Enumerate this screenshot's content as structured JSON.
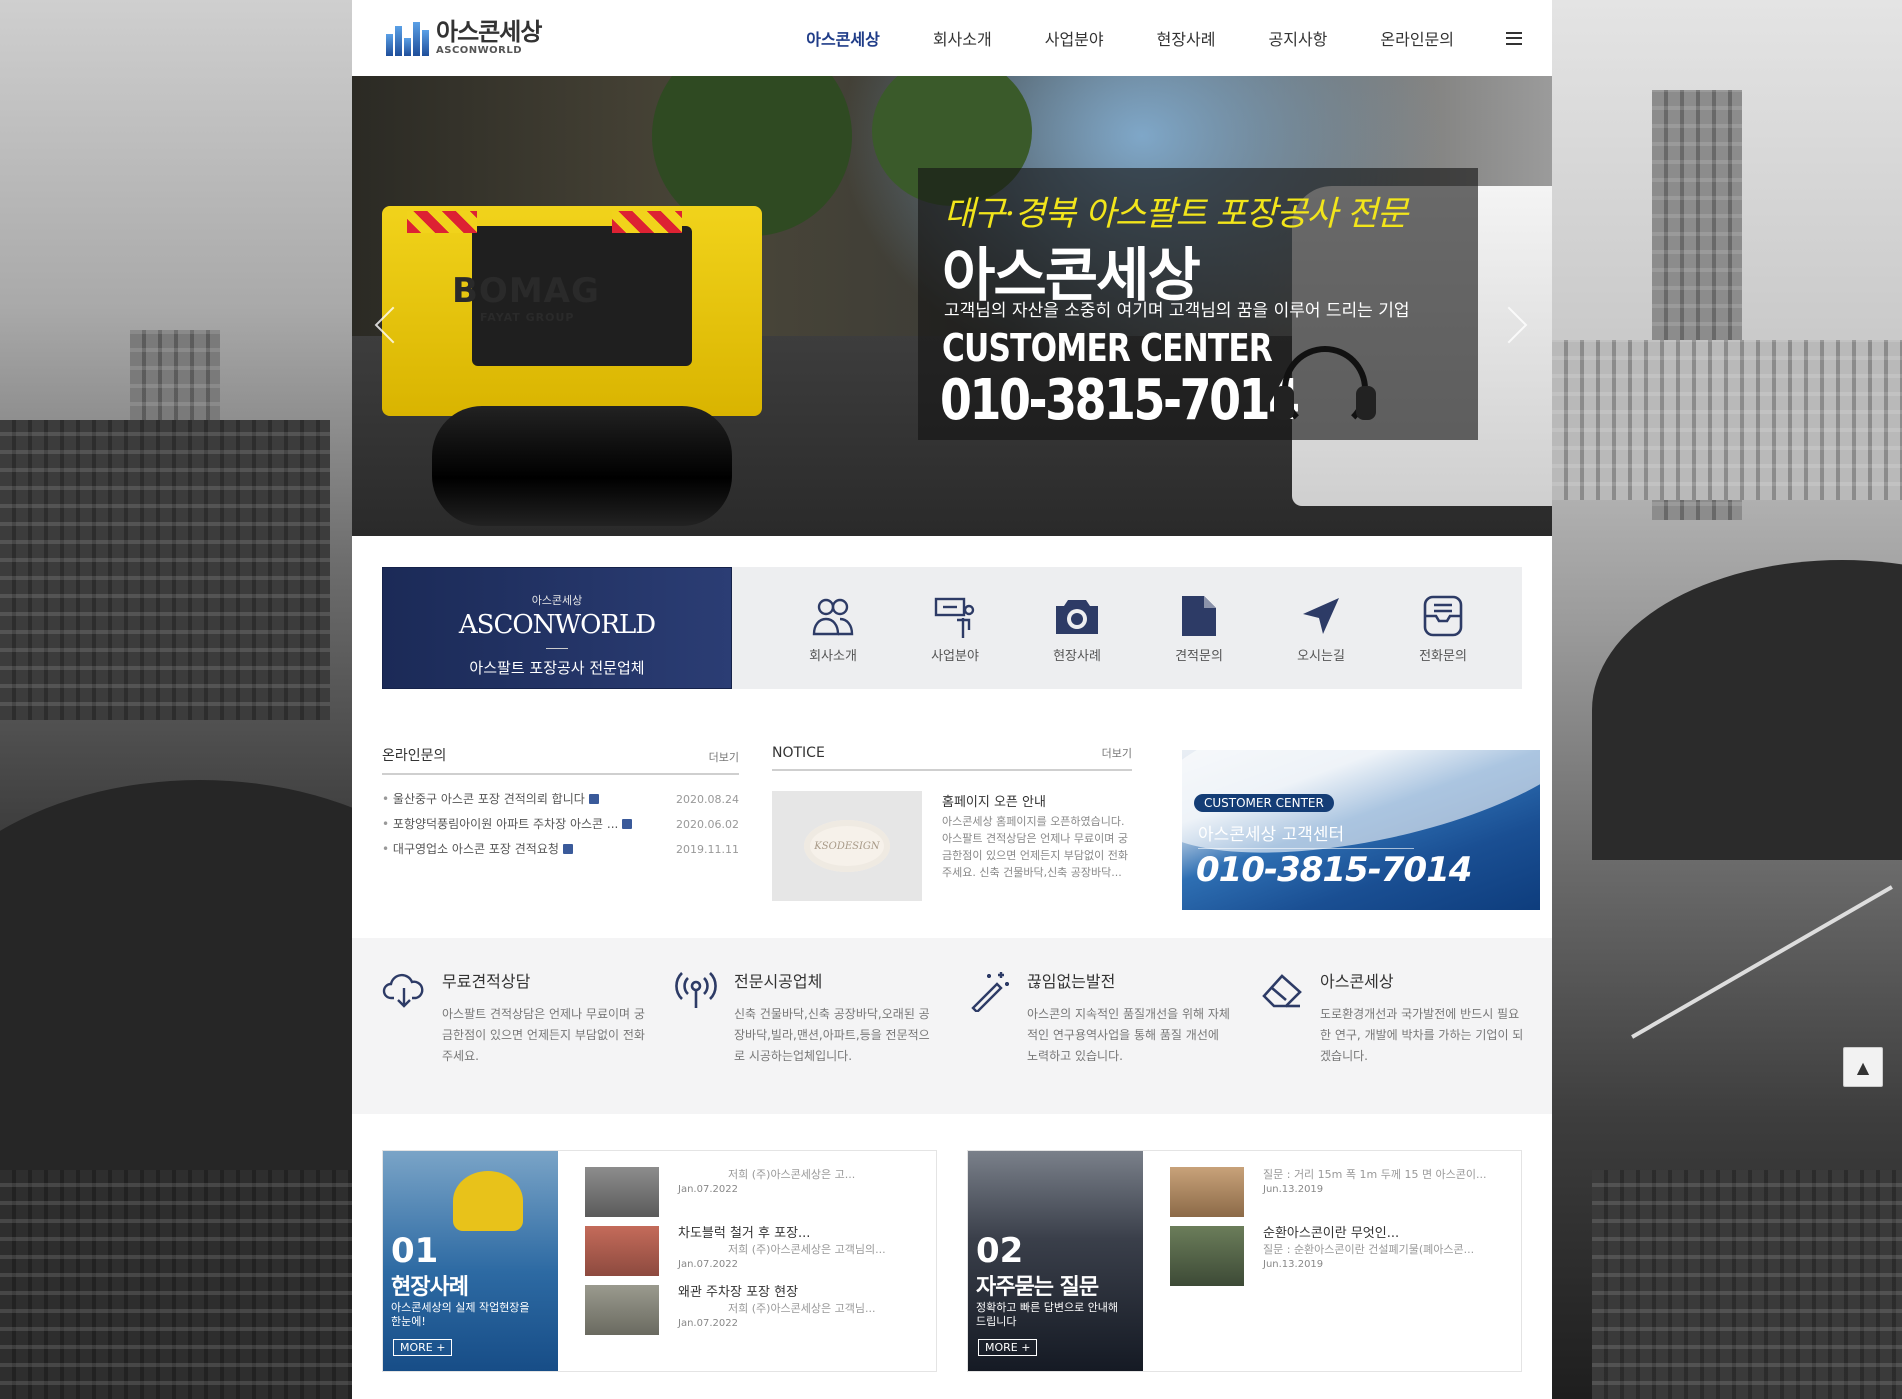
{
  "header": {
    "logo_ko": "아스콘세상",
    "logo_en": "ASCONWORLD",
    "nav": [
      "아스콘세상",
      "회사소개",
      "사업분야",
      "현장사례",
      "공지사항",
      "온라인문의"
    ],
    "active_index": 0
  },
  "hero": {
    "slogan": "대구·경북 아스팔트 포장공사 전문",
    "title": "아스콘세상",
    "subtitle": "고객님의 자산을 소중히 여기며 고객님의 꿈을 이루어 드리는 기업",
    "cc_label": "CUSTOMER CENTER",
    "phone": "010-3815-7014",
    "machine_brand": "BOMAG",
    "machine_sub": "FAYAT GROUP"
  },
  "quick": {
    "brand_small": "아스콘세상",
    "brand_big": "ASCONWORLD",
    "brand_desc": "아스팔트 포장공사 전문업체",
    "items": [
      {
        "label": "회사소개",
        "icon": "users-icon"
      },
      {
        "label": "사업분야",
        "icon": "signpost-icon"
      },
      {
        "label": "현장사례",
        "icon": "camera-icon"
      },
      {
        "label": "견적문의",
        "icon": "document-icon"
      },
      {
        "label": "오시는길",
        "icon": "navigation-arrow-icon"
      },
      {
        "label": "전화문의",
        "icon": "message-box-icon"
      }
    ]
  },
  "board_inquiry": {
    "title": "온라인문의",
    "more": "더보기",
    "posts": [
      {
        "title": "울산중구 아스콘 포장 견적의뢰 합니다",
        "date": "2020.08.24"
      },
      {
        "title": "포항양덕풍림아이원 아파트 주차장 아스콘 ...",
        "date": "2020.06.02"
      },
      {
        "title": "대구영업소 아스콘 포장 견적요청",
        "date": "2019.11.11"
      }
    ]
  },
  "board_notice": {
    "title": "NOTICE",
    "more": "더보기",
    "thumb_text": "KSODESIGN",
    "post_title": "홈페이지 오픈 안내",
    "post_body": "아스콘세상 홈페이지를 오픈하였습니다. 아스팔트 견적상담은 언제나 무료이며 궁금한점이 있으면 언제든지 부담없이 전화 주세요. 신축 건물바닥,신축 공장바닥..."
  },
  "cs_banner": {
    "label": "CUSTOMER CENTER",
    "name": "아스콘세상 고객센터",
    "phone": "010-3815-7014"
  },
  "features": [
    {
      "title": "무료견적상담",
      "desc": "아스팔트 견적상담은 언제나 무료이며 궁금한점이 있으면 언제든지 부담없이 전화 주세요.",
      "icon": "cloud-download-icon"
    },
    {
      "title": "전문시공업체",
      "desc": "신축 건물바닥,신축 공장바닥,오래된 공장바닥,빌라,맨션,아파트,등을 전문적으로 시공하는업체입니다.",
      "icon": "broadcast-icon"
    },
    {
      "title": "끊임없는발전",
      "desc": "아스콘의 지속적인 품질개선을 위해 자체적인 연구용역사업을 통해 품질 개선에 노력하고 있습니다.",
      "icon": "magic-wand-icon"
    },
    {
      "title": "아스콘세상",
      "desc": "도로환경개선과 국가발전에 반드시 필요한 연구, 개발에 박차를 가하는 기업이 되겠습니다.",
      "icon": "eraser-icon"
    }
  ],
  "gallery_cases": {
    "num": "01",
    "title": "현장사례",
    "desc": "아스콘세상의 실제 작업현장을 한눈에!",
    "more": "MORE +",
    "items": [
      {
        "title": "",
        "summary": "저희 (주)아스콘세상은 고...",
        "date": "Jan.07.2022"
      },
      {
        "title": "차도블럭 철거 후 포장...",
        "summary": "저희 (주)아스콘세상은 고객님의...",
        "date": "Jan.07.2022"
      },
      {
        "title": "왜관 주차장 포장 현장",
        "summary": "저희 (주)아스콘세상은 고객님...",
        "date": "Jan.07.2022"
      }
    ]
  },
  "gallery_faq": {
    "num": "02",
    "title": "자주묻는 질문",
    "desc": "정확하고 빠른 답변으로 안내해드립니다",
    "more": "MORE +",
    "items": [
      {
        "title": "",
        "summary": "질문 : 거리 15m 폭 1m 두께 15 면 아스콘이...",
        "date": "Jun.13.2019"
      },
      {
        "title": "순환아스콘이란 무엇인...",
        "summary": "질문 : 순환아스콘이란 건설폐기물(폐아스콘...",
        "date": "Jun.13.2019"
      }
    ]
  },
  "totop": "▲"
}
